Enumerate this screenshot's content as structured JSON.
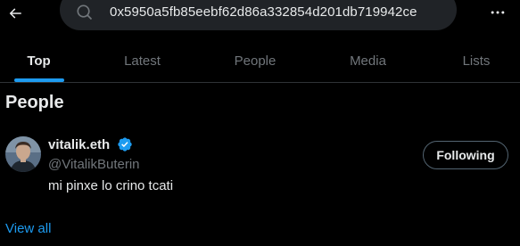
{
  "header": {
    "search_value": "0x5950a5fb85eebf62d86a332854d201db719942ce",
    "back_icon": "arrow-left-icon",
    "search_icon": "search-icon",
    "more_icon": "ellipsis-icon"
  },
  "tabs": [
    {
      "label": "Top",
      "active": true
    },
    {
      "label": "Latest",
      "active": false
    },
    {
      "label": "People",
      "active": false
    },
    {
      "label": "Media",
      "active": false
    },
    {
      "label": "Lists",
      "active": false
    }
  ],
  "section": {
    "title": "People",
    "users": [
      {
        "name": "vitalik.eth",
        "verified": true,
        "handle": "@VitalikButerin",
        "bio": "mi pinxe lo crino tcati",
        "follow_label": "Following"
      }
    ],
    "view_all_label": "View all"
  },
  "colors": {
    "background": "#000000",
    "accent": "#1d9bf0",
    "text_primary": "#e7e9ea",
    "text_secondary": "#71767b",
    "search_bg": "#202327",
    "divider": "#2f3336"
  }
}
